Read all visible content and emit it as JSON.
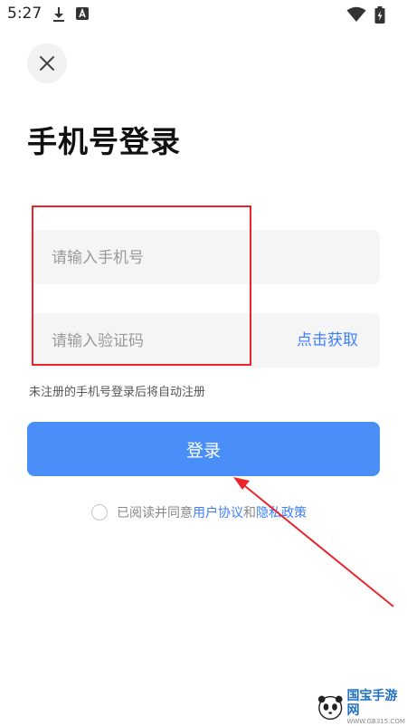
{
  "status_bar": {
    "time": "5:27",
    "icons": [
      "download-icon",
      "notification-a-icon",
      "wifi-icon",
      "battery-icon"
    ]
  },
  "header": {
    "close_icon": "close-icon"
  },
  "title": "手机号登录",
  "form": {
    "phone_placeholder": "请输入手机号",
    "code_placeholder": "请输入验证码",
    "get_code_label": "点击获取",
    "hint": "未注册的手机号登录后将自动注册",
    "login_label": "登录"
  },
  "agreement": {
    "prefix": "已阅读并同意",
    "user_agreement": "用户协议",
    "and": "和",
    "privacy_policy": "隐私政策",
    "checked": false
  },
  "watermark": {
    "name": "国宝手游网",
    "url": "WWW.GB315.COM"
  },
  "colors": {
    "accent": "#3d7fff",
    "button": "#4a8ff7",
    "annotation": "#e8262b"
  }
}
